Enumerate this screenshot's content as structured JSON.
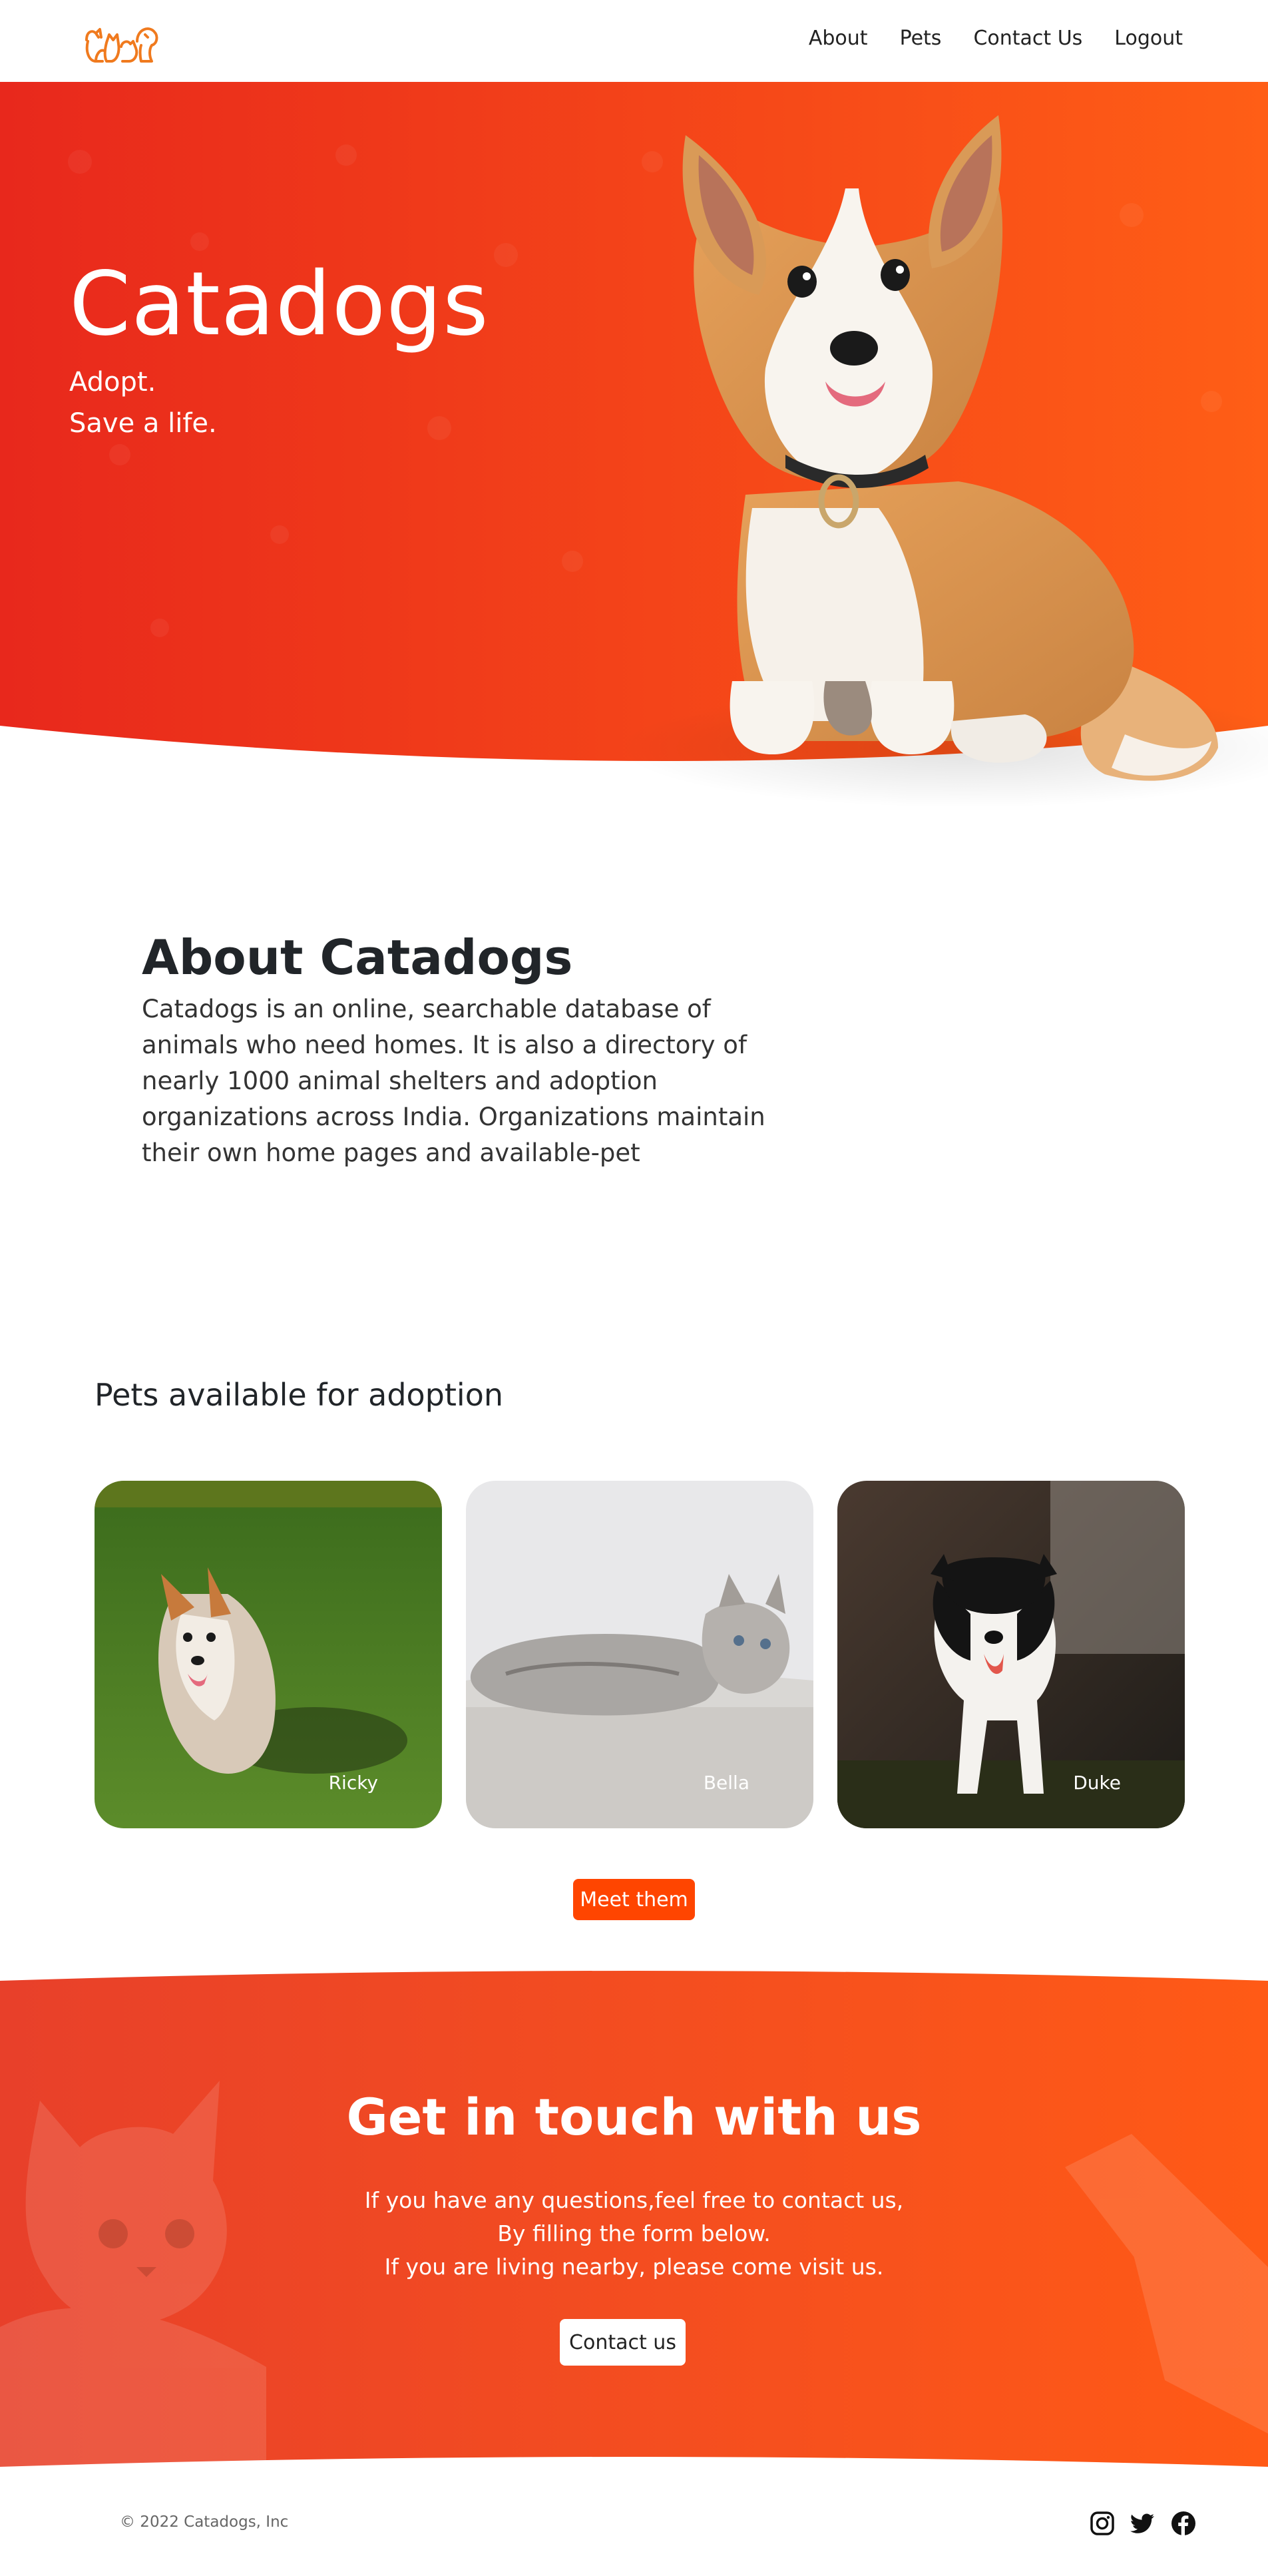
{
  "nav": {
    "links": [
      "About",
      "Pets",
      "Contact Us",
      "Logout"
    ]
  },
  "hero": {
    "title": "Catadogs",
    "tagline_1": "Adopt.",
    "tagline_2": "Save a life."
  },
  "about": {
    "heading": "About Catadogs",
    "body": "Catadogs is an online, searchable database of animals who need homes. It is also a directory of nearly 1000 animal shelters and adoption organizations across India. Organizations maintain their own home pages and available-pet"
  },
  "pets": {
    "heading": "Pets available for adoption",
    "items": [
      {
        "name": "Ricky"
      },
      {
        "name": "Bella"
      },
      {
        "name": "Duke"
      }
    ],
    "button": "Meet them"
  },
  "contact": {
    "heading": "Get in touch with us",
    "line_1": "If you have any questions,feel free to contact us,",
    "line_2": "By filling the form below.",
    "line_3": "If you are living nearby, please come visit us.",
    "button": "Contact us"
  },
  "footer": {
    "copyright": "© 2022 Catadogs, Inc",
    "social_icons": [
      "instagram-icon",
      "twitter-icon",
      "facebook-icon"
    ]
  },
  "colors": {
    "brand_orange": "#ff4500",
    "hero_gradient_start": "#e8281c",
    "hero_gradient_end": "#ff5a14"
  }
}
